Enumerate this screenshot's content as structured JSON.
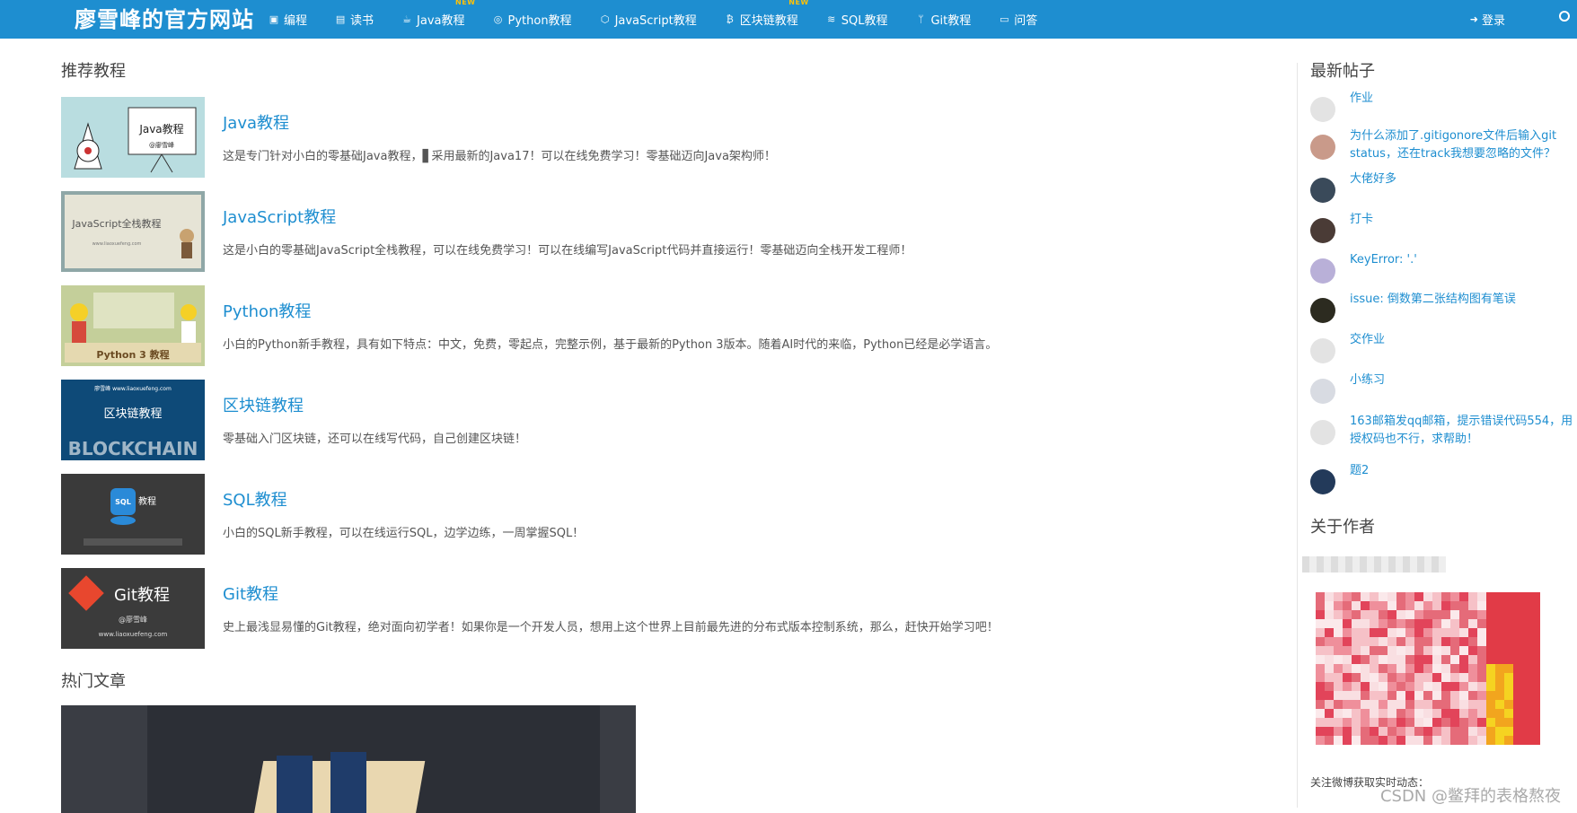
{
  "header": {
    "brand": "廖雪峰的官方网站",
    "nav": [
      {
        "label": "编程",
        "icon": "code-icon",
        "glyph": "▣",
        "badge": ""
      },
      {
        "label": "读书",
        "icon": "book-icon",
        "glyph": "▤",
        "badge": ""
      },
      {
        "label": "Java教程",
        "icon": "coffee-icon",
        "glyph": "☕",
        "badge": "NEW"
      },
      {
        "label": "Python教程",
        "icon": "python-icon",
        "glyph": "◎",
        "badge": ""
      },
      {
        "label": "JavaScript教程",
        "icon": "js-icon",
        "glyph": "⬡",
        "badge": ""
      },
      {
        "label": "区块链教程",
        "icon": "bitcoin-icon",
        "glyph": "₿",
        "badge": "NEW"
      },
      {
        "label": "SQL教程",
        "icon": "database-icon",
        "glyph": "≋",
        "badge": ""
      },
      {
        "label": "Git教程",
        "icon": "git-branch-icon",
        "glyph": "ᛘ",
        "badge": ""
      },
      {
        "label": "问答",
        "icon": "chat-icon",
        "glyph": "▭",
        "badge": ""
      }
    ],
    "login": "登录"
  },
  "main": {
    "recommend_title": "推荐教程",
    "courses": [
      {
        "title": "Java教程",
        "desc": "这是专门针对小白的零基础Java教程，▋采用最新的Java17！可以在线免费学习！零基础迈向Java架构师！",
        "thumb_text": "Java教程",
        "thumb_sub": "@廖雪峰"
      },
      {
        "title": "JavaScript教程",
        "desc": "这是小白的零基础JavaScript全栈教程，可以在线免费学习！可以在线编写JavaScript代码并直接运行！零基础迈向全栈开发工程师！",
        "thumb_text": "JavaScript全栈教程",
        "thumb_sub": "www.liaoxuefeng.com"
      },
      {
        "title": "Python教程",
        "desc": "小白的Python新手教程，具有如下特点：中文，免费，零起点，完整示例，基于最新的Python 3版本。随着AI时代的来临，Python已经是必学语言。",
        "thumb_text": "Python 3 教程",
        "thumb_sub": ""
      },
      {
        "title": "区块链教程",
        "desc": "零基础入门区块链，还可以在线写代码，自己创建区块链！",
        "thumb_text": "区块链教程",
        "thumb_sub": "廖雪峰 www.liaoxuefeng.com",
        "thumb_extra": "BLOCKCHAIN"
      },
      {
        "title": "SQL教程",
        "desc": "小白的SQL新手教程，可以在线运行SQL，边学边练，一周掌握SQL！",
        "thumb_text": "教程",
        "thumb_sub": "SQL"
      },
      {
        "title": "Git教程",
        "desc": "史上最浅显易懂的Git教程，绝对面向初学者！如果你是一个开发人员，想用上这个世界上目前最先进的分布式版本控制系统，那么，赶快开始学习吧！",
        "thumb_text": "Git教程",
        "thumb_sub": "@廖雪峰",
        "thumb_extra": "www.liaoxuefeng.com"
      }
    ],
    "hot_title": "热门文章"
  },
  "sidebar": {
    "posts_title": "最新帖子",
    "posts": [
      {
        "text": "作业"
      },
      {
        "text": "为什么添加了.gitigonore文件后输入git status，还在track我想要忽略的文件？"
      },
      {
        "text": "大佬好多"
      },
      {
        "text": "打卡"
      },
      {
        "text": "KeyError: '.'"
      },
      {
        "text": "issue: 倒数第二张结构图有笔误"
      },
      {
        "text": "交作业"
      },
      {
        "text": "小练习"
      },
      {
        "text": "163邮箱发qq邮箱，提示错误代码554，用授权码也不行，求帮助！"
      },
      {
        "text": "题2"
      }
    ],
    "about_title": "关于作者",
    "weibo_text": "关注微博获取实时动态："
  },
  "watermark": "CSDN @鳖拜的表格熬夜",
  "colors": {
    "brand": "#1e8ed0",
    "badge": "#ffc107"
  }
}
